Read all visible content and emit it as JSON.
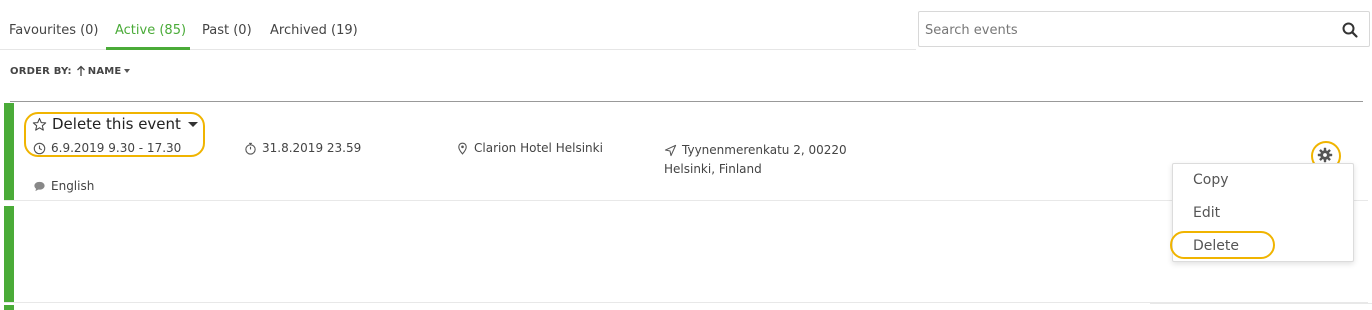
{
  "tabs": [
    {
      "label": "Favourites (0)",
      "active": false
    },
    {
      "label": "Active (85)",
      "active": true
    },
    {
      "label": "Past (0)",
      "active": false
    },
    {
      "label": "Archived (19)",
      "active": false
    }
  ],
  "search": {
    "placeholder": "Search events",
    "icon": "search-icon"
  },
  "order": {
    "label": "ORDER BY:",
    "direction": "ascending",
    "field": "NAME"
  },
  "events": [
    {
      "title": "Delete this event",
      "date_range": "6.9.2019 9.30 - 17.30",
      "deadline": "31.8.2019 23.59",
      "venue": "Clarion Hotel Helsinki",
      "address_line1": "Tyynenmerenkatu 2, 00220",
      "address_line2": "Helsinki, Finland",
      "language": "English"
    }
  ],
  "menu": {
    "items": [
      "Copy",
      "Edit",
      "Delete"
    ]
  },
  "colors": {
    "accent": "#4aab38",
    "highlight": "#f0b400",
    "status_bar": "#4aab38"
  }
}
